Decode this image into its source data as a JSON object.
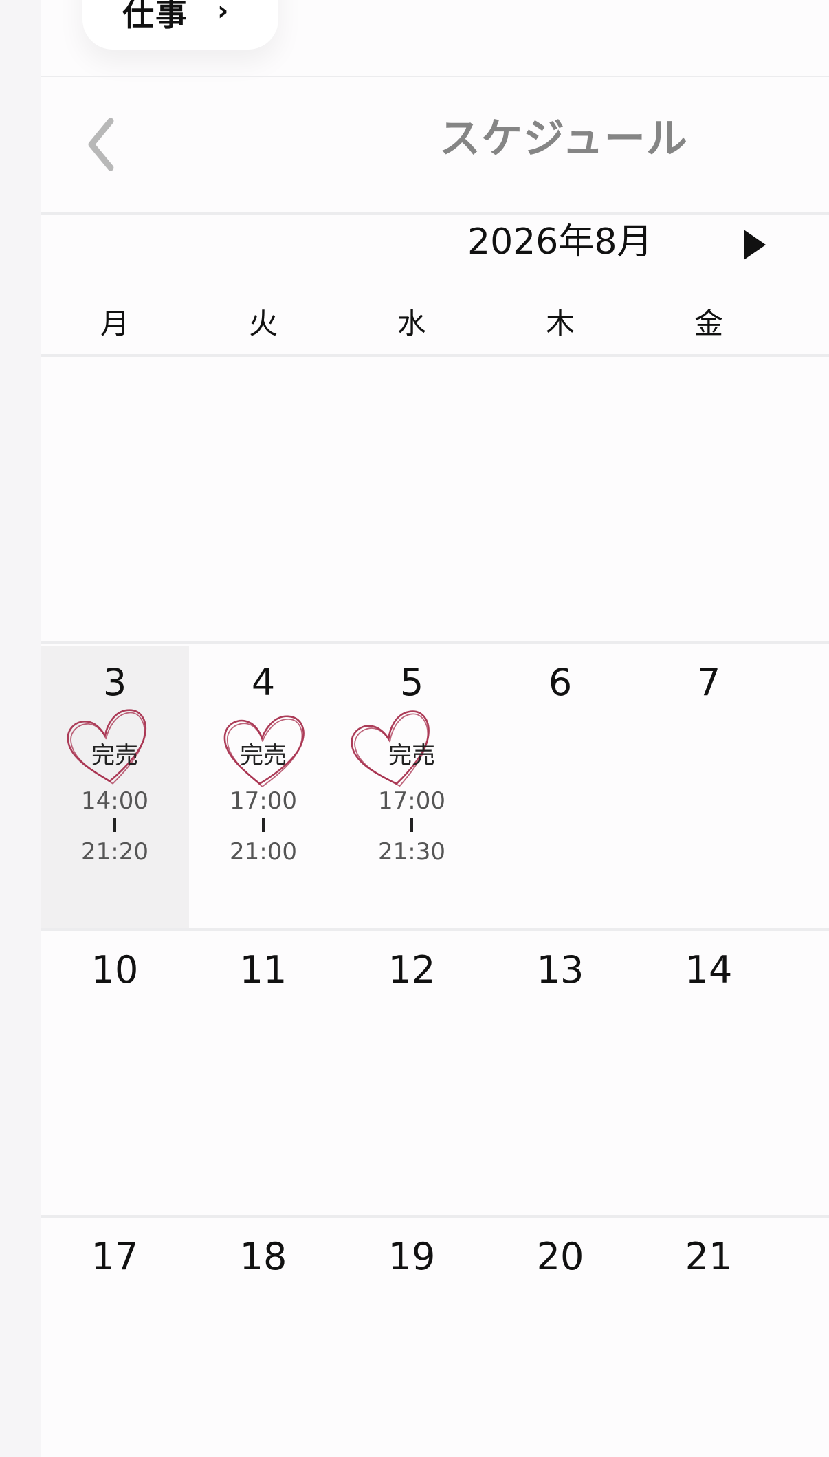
{
  "top_button": {
    "label": "仕事",
    "chevron": "›"
  },
  "header": {
    "title": "スケジュール",
    "back_icon": "chevron-left-icon"
  },
  "month_nav": {
    "label": "2026年8月",
    "next_icon": "play-triangle-icon"
  },
  "weekdays": [
    "月",
    "火",
    "水",
    "木",
    "金"
  ],
  "weeks": [
    {
      "days": []
    },
    {
      "days": [
        {
          "number": "3",
          "highlighted": true,
          "event": {
            "status": "完売",
            "start": "14:00",
            "end": "21:20"
          }
        },
        {
          "number": "4",
          "event": {
            "status": "完売",
            "start": "17:00",
            "end": "21:00"
          }
        },
        {
          "number": "5",
          "event": {
            "status": "完売",
            "start": "17:00",
            "end": "21:30"
          }
        },
        {
          "number": "6"
        },
        {
          "number": "7"
        }
      ]
    },
    {
      "days": [
        {
          "number": "10"
        },
        {
          "number": "11"
        },
        {
          "number": "12"
        },
        {
          "number": "13"
        },
        {
          "number": "14"
        }
      ]
    },
    {
      "days": [
        {
          "number": "17"
        },
        {
          "number": "18"
        },
        {
          "number": "19"
        },
        {
          "number": "20"
        },
        {
          "number": "21"
        }
      ]
    }
  ],
  "colors": {
    "heart_stroke": "#a8324f",
    "title_gray": "#858585",
    "highlight_bg": "#f1f0f1",
    "divider": "#ececee"
  }
}
